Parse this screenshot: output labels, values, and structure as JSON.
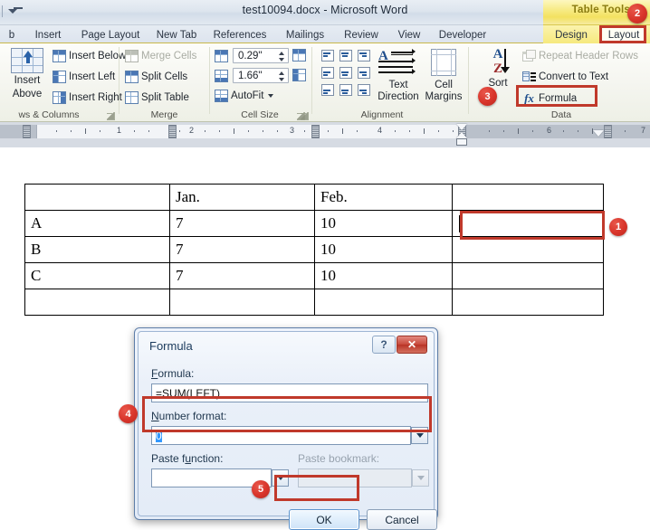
{
  "window": {
    "title": "test10094.docx  -  Microsoft Word",
    "contextual_tools_title": "Table Tools",
    "qat_icon": "customize-quick-access-toolbar-icon"
  },
  "tabs": [
    {
      "label": "b",
      "selected": false
    },
    {
      "label": "Insert",
      "selected": false
    },
    {
      "label": "Page Layout",
      "selected": false
    },
    {
      "label": "New Tab",
      "selected": false
    },
    {
      "label": "References",
      "selected": false
    },
    {
      "label": "Mailings",
      "selected": false
    },
    {
      "label": "Review",
      "selected": false
    },
    {
      "label": "View",
      "selected": false
    },
    {
      "label": "Developer",
      "selected": false
    },
    {
      "label": "Design",
      "selected": false
    },
    {
      "label": "Layout",
      "selected": true
    }
  ],
  "ribbon": {
    "groups": [
      {
        "label": "ws & Columns"
      },
      {
        "label": "Merge"
      },
      {
        "label": "Cell Size"
      },
      {
        "label": "Alignment"
      },
      {
        "label": "Data"
      }
    ],
    "rows_columns": {
      "insert_above": "Insert\nAbove",
      "insert_above_line1": "Insert",
      "insert_above_line2": "Above",
      "insert_below": "Insert Below",
      "insert_left": "Insert Left",
      "insert_right": "Insert Right"
    },
    "merge": {
      "merge_cells": "Merge Cells",
      "split_cells": "Split Cells",
      "split_table": "Split Table"
    },
    "cell_size": {
      "height_value": "0.29\"",
      "width_value": "1.66\"",
      "autofit": "AutoFit"
    },
    "data": {
      "sort": "Sort",
      "repeat_header_rows": "Repeat Header Rows",
      "convert_to_text": "Convert to Text",
      "formula": "Formula"
    },
    "alignment": {
      "text_direction_line1": "Text",
      "text_direction_line2": "Direction",
      "cell_margins_line1": "Cell",
      "cell_margins_line2": "Margins"
    }
  },
  "ruler": {
    "tick_labels": [
      "1",
      "2",
      "3",
      "4",
      "6",
      "7"
    ]
  },
  "document": {
    "table": {
      "rows": [
        [
          "",
          "Jan.",
          "Feb.",
          ""
        ],
        [
          "A",
          "7",
          "10",
          ""
        ],
        [
          "B",
          "7",
          "10",
          ""
        ],
        [
          "C",
          "7",
          "10",
          ""
        ],
        [
          "",
          "",
          "",
          ""
        ]
      ],
      "cursor_cell": {
        "row": 1,
        "col": 3
      }
    }
  },
  "dialog": {
    "title": "Formula",
    "help_glyph": "?",
    "close_glyph": "✕",
    "formula_label": "Formula:",
    "formula_value": "=SUM(LEFT)",
    "number_format_label": "Number format:",
    "number_format_value": "0",
    "paste_function_label": "Paste function:",
    "paste_function_value": "",
    "paste_bookmark_label": "Paste bookmark:",
    "paste_bookmark_value": "",
    "ok_label": "OK",
    "cancel_label": "Cancel"
  },
  "annotations": {
    "badges": [
      {
        "number": "1",
        "target": "table-cell-highlight"
      },
      {
        "number": "2",
        "target": "layout-tab"
      },
      {
        "number": "3",
        "target": "formula-button"
      },
      {
        "number": "4",
        "target": "number-format-field"
      },
      {
        "number": "5",
        "target": "ok-button"
      }
    ],
    "accent_color": "#c0392b"
  }
}
